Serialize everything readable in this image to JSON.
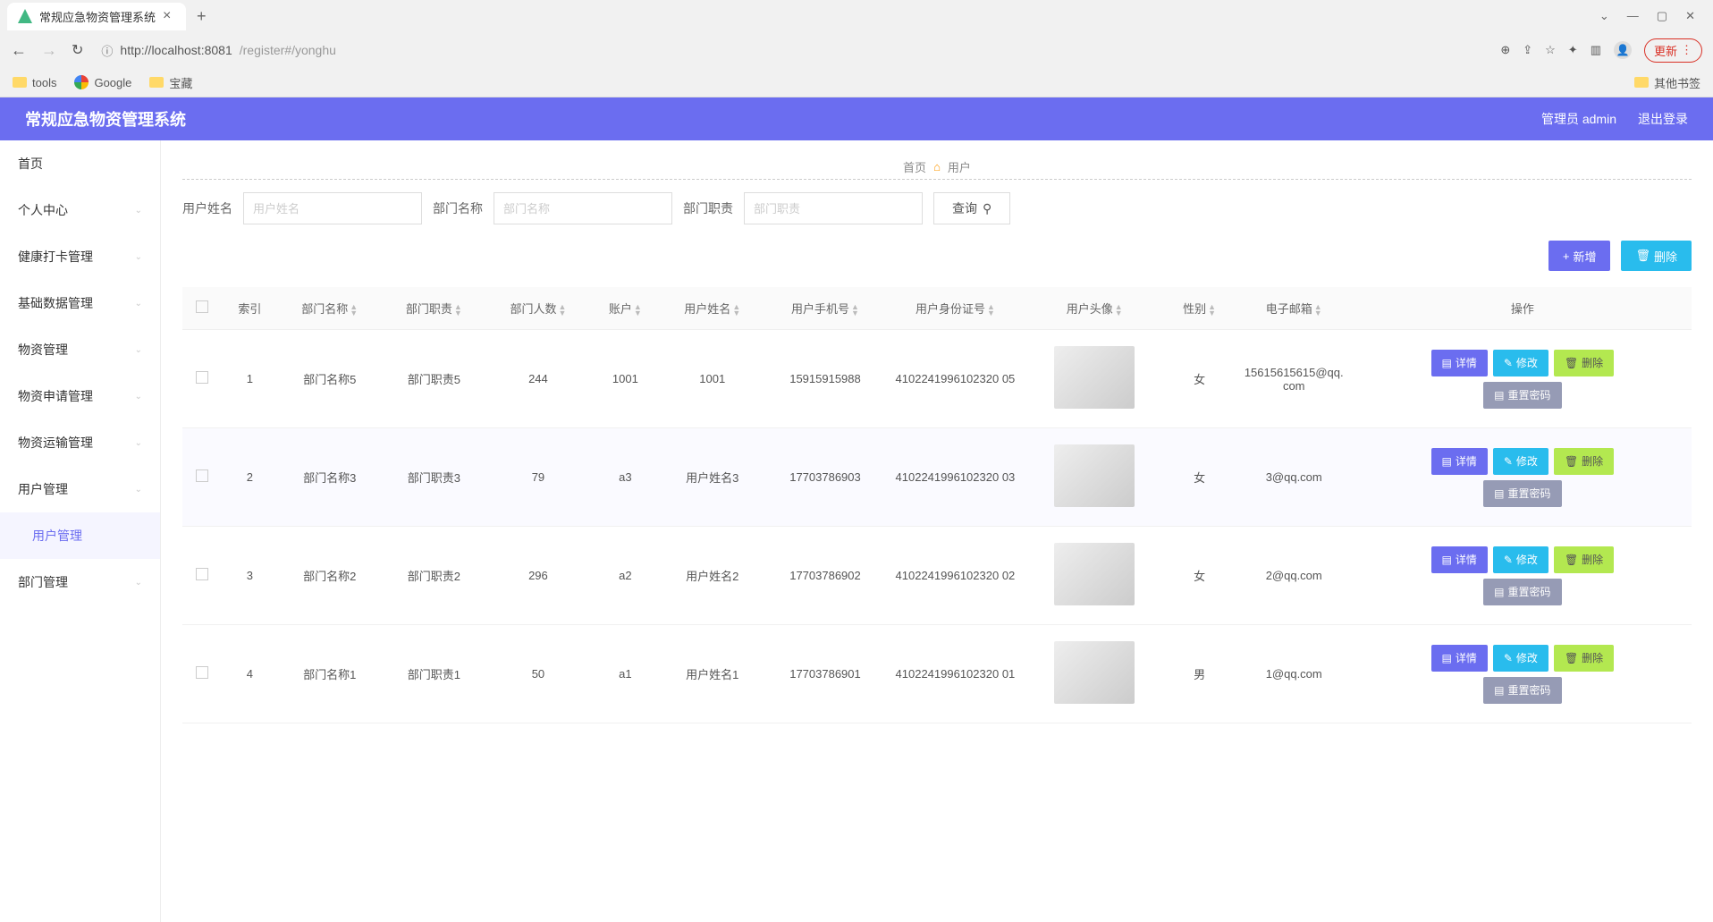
{
  "browser": {
    "tab_title": "常规应急物资管理系统",
    "url_host": "http://localhost:8081",
    "url_path": "/register#/yonghu",
    "update_label": "更新",
    "vert_dots": "⋮"
  },
  "bookmarks": {
    "tools": "tools",
    "google": "Google",
    "baozang": "宝藏",
    "other": "其他书签"
  },
  "header": {
    "app_title": "常规应急物资管理系统",
    "user_label": "管理员 admin",
    "logout": "退出登录"
  },
  "sidebar": {
    "home": "首页",
    "personal": "个人中心",
    "health": "健康打卡管理",
    "basedata": "基础数据管理",
    "material": "物资管理",
    "apply": "物资申请管理",
    "transport": "物资运输管理",
    "usermgmt": "用户管理",
    "usermgmt_sub": "用户管理",
    "deptmgmt": "部门管理"
  },
  "breadcrumb": {
    "home": "首页",
    "current": "用户"
  },
  "search": {
    "name_label": "用户姓名",
    "name_ph": "用户姓名",
    "dept_label": "部门名称",
    "dept_ph": "部门名称",
    "duty_label": "部门职责",
    "duty_ph": "部门职责",
    "query": "查询"
  },
  "actions": {
    "add": "新增",
    "delete": "删除"
  },
  "table": {
    "cols": {
      "index": "索引",
      "dept_name": "部门名称",
      "dept_duty": "部门职责",
      "dept_count": "部门人数",
      "account": "账户",
      "user_name": "用户姓名",
      "phone": "用户手机号",
      "id_no": "用户身份证号",
      "avatar": "用户头像",
      "gender": "性别",
      "email": "电子邮箱",
      "ops": "操作"
    },
    "ops": {
      "detail": "详情",
      "edit": "修改",
      "delete": "删除",
      "reset": "重置密码"
    },
    "rows": [
      {
        "idx": "1",
        "dept": "部门名称5",
        "duty": "部门职责5",
        "count": "244",
        "acct": "1001",
        "name": "1001",
        "phone": "15915915988",
        "idno": "4102241996102320 05",
        "gender": "女",
        "email": "1561561561​5@qq.com"
      },
      {
        "idx": "2",
        "dept": "部门名称3",
        "duty": "部门职责3",
        "count": "79",
        "acct": "a3",
        "name": "用户姓名3",
        "phone": "17703786903",
        "idno": "4102241996102320 03",
        "gender": "女",
        "email": "3@qq.com"
      },
      {
        "idx": "3",
        "dept": "部门名称2",
        "duty": "部门职责2",
        "count": "296",
        "acct": "a2",
        "name": "用户姓名2",
        "phone": "17703786902",
        "idno": "4102241996102320 02",
        "gender": "女",
        "email": "2@qq.com"
      },
      {
        "idx": "4",
        "dept": "部门名称1",
        "duty": "部门职责1",
        "count": "50",
        "acct": "a1",
        "name": "用户姓名1",
        "phone": "17703786901",
        "idno": "4102241996102320 01",
        "gender": "男",
        "email": "1@qq.com"
      }
    ]
  }
}
